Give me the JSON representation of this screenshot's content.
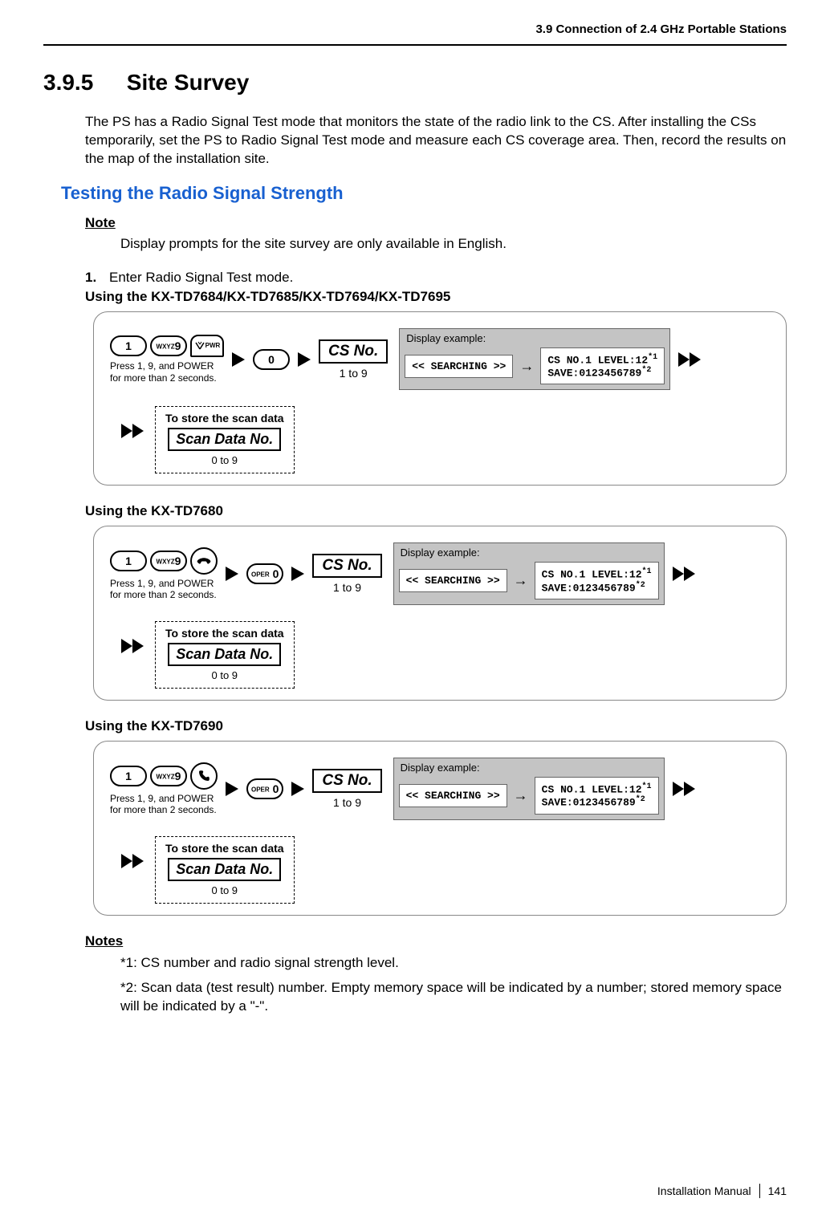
{
  "header": {
    "section": "3.9 Connection of 2.4 GHz Portable Stations"
  },
  "title": {
    "number": "3.9.5",
    "text": "Site Survey"
  },
  "intro": "The PS has a Radio Signal Test mode that monitors the state of the radio link to the CS. After installing the CSs temporarily, set the PS to Radio Signal Test mode and measure each CS coverage area. Then, record the results on the map of the installation site.",
  "subheading": "Testing the Radio Signal Strength",
  "note": {
    "label": "Note",
    "text": "Display prompts for the site survey are only available in English."
  },
  "step1": {
    "num": "1.",
    "text": "Enter Radio Signal Test mode."
  },
  "flows": [
    {
      "heading": "Using the KX-TD7684/KX-TD7685/KX-TD7694/KX-TD7695",
      "key1": "1",
      "key9_small": "WXYZ",
      "key9": "9",
      "third_key_type": "pwr",
      "third_key_label": "PWR",
      "press_note": "Press 1, 9, and POWER\nfor more than 2 seconds.",
      "zero_prefix": "",
      "zero_key": "0",
      "cs_label": "CS No.",
      "cs_range": "1 to 9",
      "display_label": "Display example:",
      "lcd_searching": "<< SEARCHING >>",
      "lcd_line1": "CS NO.1 LEVEL:12",
      "lcd_sup1": "*1",
      "lcd_line2": "SAVE:0123456789",
      "lcd_sup2": "*2",
      "store_label": "To store the scan data",
      "scan_label": "Scan Data No.",
      "scan_range": "0 to 9"
    },
    {
      "heading": "Using the KX-TD7680",
      "key1": "1",
      "key9_small": "WXYZ",
      "key9": "9",
      "third_key_type": "hangup",
      "third_key_label": "",
      "press_note": "Press 1, 9, and POWER\nfor more than 2 seconds.",
      "zero_prefix": "OPER",
      "zero_key": "0",
      "cs_label": "CS No.",
      "cs_range": "1 to 9",
      "display_label": "Display example:",
      "lcd_searching": "<< SEARCHING >>",
      "lcd_line1": "CS NO.1 LEVEL:12",
      "lcd_sup1": "*1",
      "lcd_line2": "SAVE:0123456789",
      "lcd_sup2": "*2",
      "store_label": "To store the scan data",
      "scan_label": "Scan Data No.",
      "scan_range": "0 to 9"
    },
    {
      "heading": "Using the KX-TD7690",
      "key1": "1",
      "key9_small": "WXYZ",
      "key9": "9",
      "third_key_type": "talk",
      "third_key_label": "",
      "press_note": "Press 1, 9, and POWER\nfor more than 2 seconds.",
      "zero_prefix": "OPER",
      "zero_key": "0",
      "cs_label": "CS No.",
      "cs_range": "1 to 9",
      "display_label": "Display example:",
      "lcd_searching": "<< SEARCHING >>",
      "lcd_line1": "CS NO.1 LEVEL:12",
      "lcd_sup1": "*1",
      "lcd_line2": "SAVE:0123456789",
      "lcd_sup2": "*2",
      "store_label": "To store the scan data",
      "scan_label": "Scan Data No.",
      "scan_range": "0 to 9"
    }
  ],
  "notes": {
    "label": "Notes",
    "n1": "*1: CS number and radio signal strength level.",
    "n2": "*2: Scan data (test result) number. Empty memory space will be indicated by a number; stored memory space will be indicated by a \"-\"."
  },
  "footer": {
    "doc": "Installation Manual",
    "page": "141"
  }
}
